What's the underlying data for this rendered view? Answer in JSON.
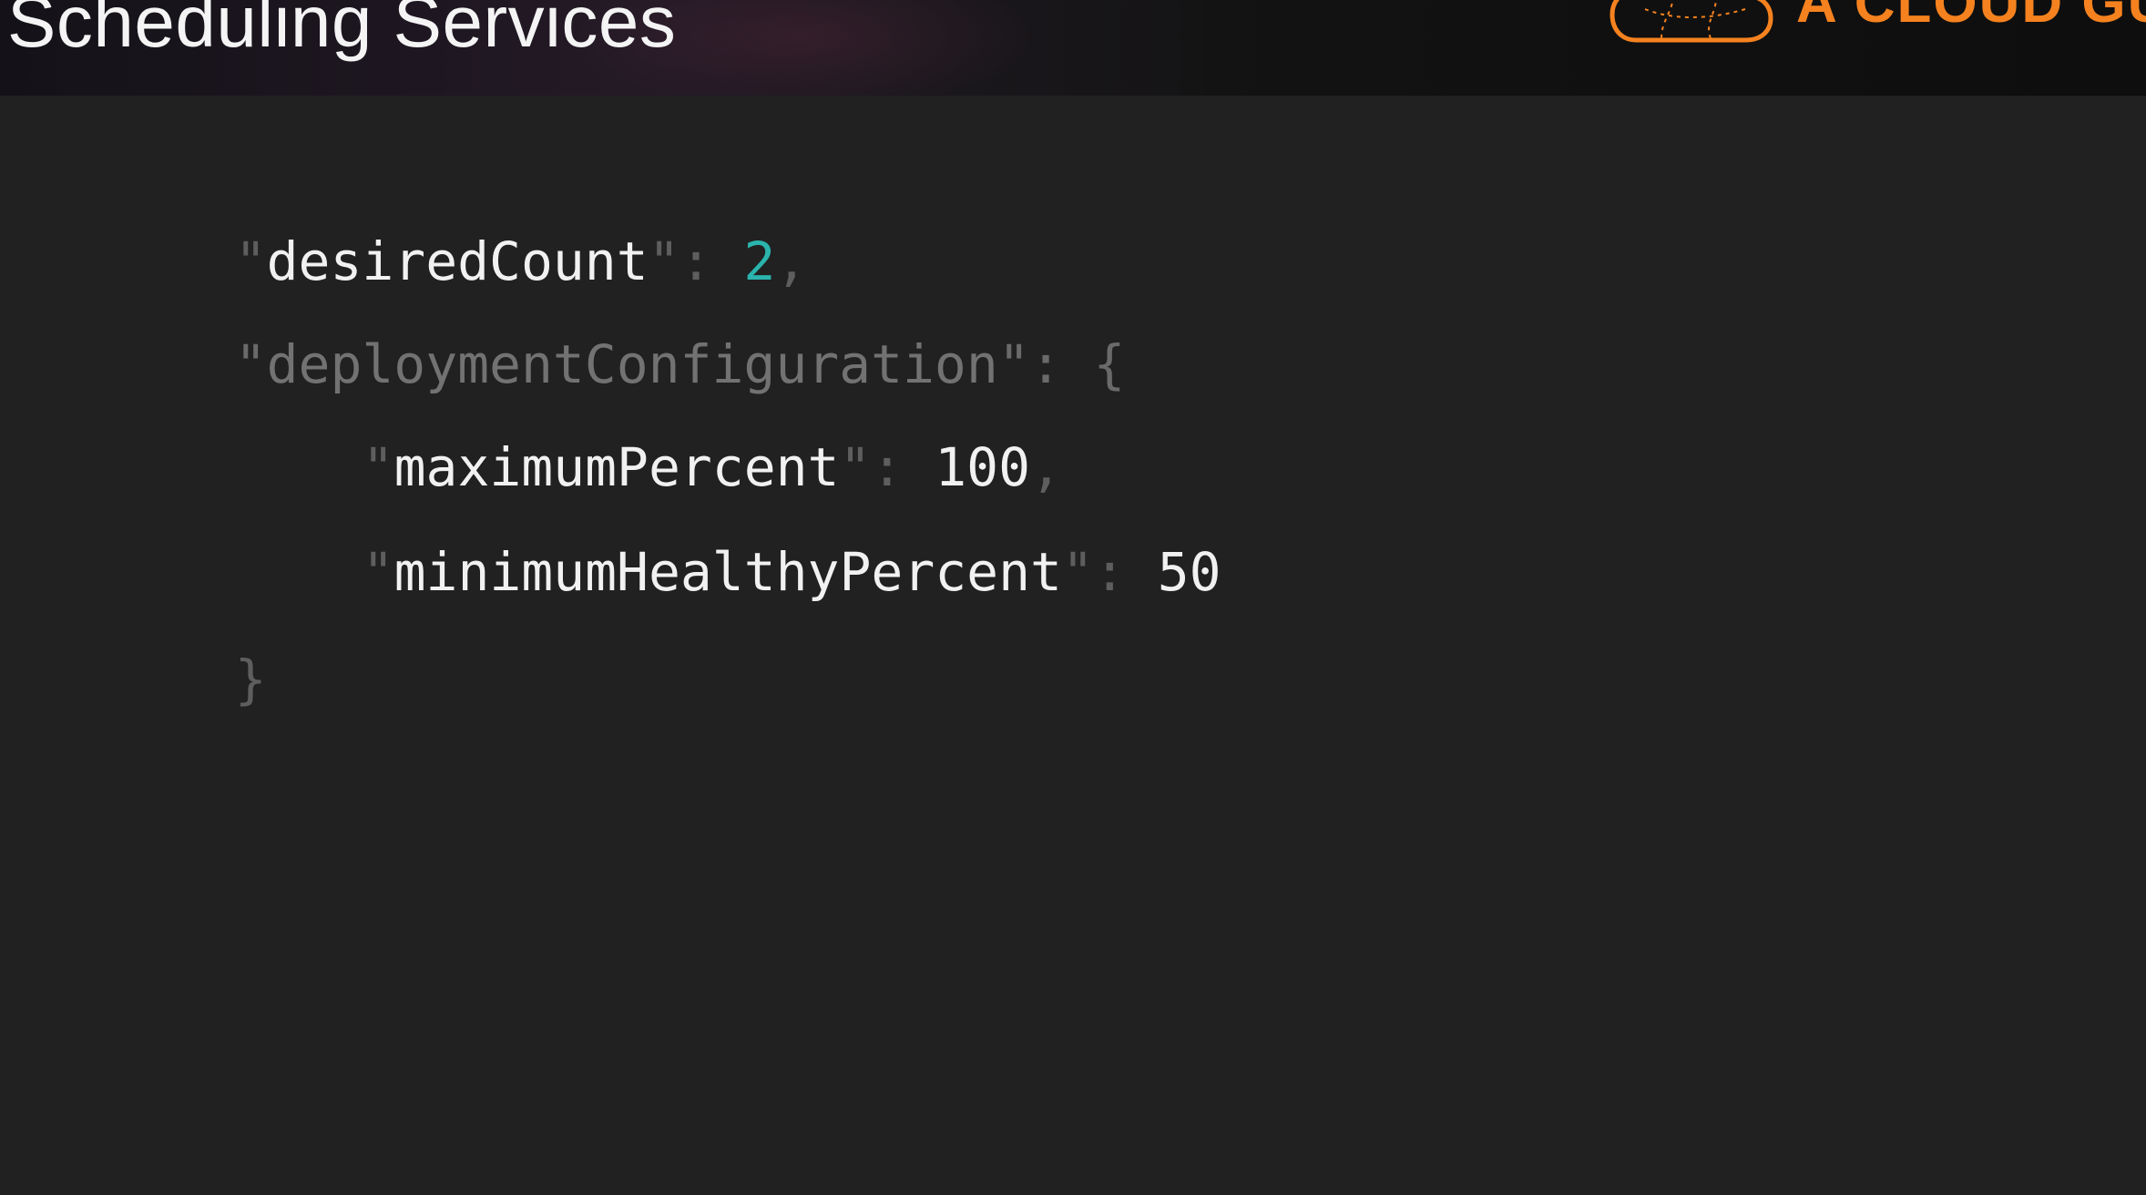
{
  "slide": {
    "title": "Scheduling Services",
    "logo_text": "A CLOUD GU",
    "logo_icon": "cloud-icon",
    "accent_color": "#f5821f",
    "background_color": "#212121"
  },
  "code": {
    "line1": {
      "quote_open": "\"",
      "key": "desiredCount",
      "quote_close": "\"",
      "colon": ": ",
      "value": "2",
      "comma": ","
    },
    "line2": {
      "quote_open": "\"",
      "key": "deploymentConfiguration",
      "quote_close": "\"",
      "colon": ": ",
      "brace": "{"
    },
    "line3": {
      "quote_open": "\"",
      "key": "maximumPercent",
      "quote_close": "\"",
      "colon": ": ",
      "value": "100",
      "comma": ","
    },
    "line4": {
      "quote_open": "\"",
      "key": "minimumHealthyPercent",
      "quote_close": "\"",
      "colon": ": ",
      "value": "50"
    },
    "line5": {
      "brace": "}"
    },
    "value_highlight_color": "#2bb3ad"
  }
}
